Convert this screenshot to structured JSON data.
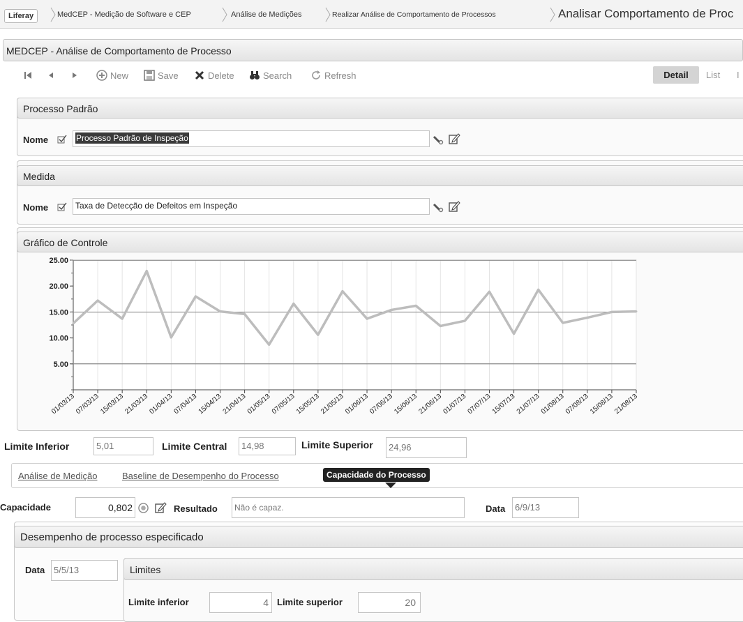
{
  "breadcrumb": {
    "items": [
      "Liferay",
      "MedCEP - Medição de Software e CEP",
      "Análise de Medições",
      "Realizar Análise de Comportamento de Processos"
    ],
    "current": "Analisar Comportamento de Proc"
  },
  "window": {
    "title": "MEDCEP - Análise de Comportamento de Processo"
  },
  "toolbar": {
    "new_label": "New",
    "save_label": "Save",
    "delete_label": "Delete",
    "search_label": "Search",
    "refresh_label": "Refresh",
    "view_detail": "Detail",
    "view_list": "List",
    "view_more": "I"
  },
  "processo": {
    "title": "Processo Padrão",
    "nome_label": "Nome",
    "nome_value": "Processo Padrão de Inspeção"
  },
  "medida": {
    "title": "Medida",
    "nome_label": "Nome",
    "nome_value": "Taxa de Detecção de Defeitos em Inspeção"
  },
  "grafico": {
    "title": "Gráfico de Controle"
  },
  "chart_data": {
    "type": "line",
    "x": [
      "01/03/13",
      "07/03/13",
      "15/03/13",
      "21/03/13",
      "01/04/13",
      "07/04/13",
      "15/04/13",
      "21/04/13",
      "01/05/13",
      "07/05/13",
      "15/05/13",
      "21/05/13",
      "01/06/13",
      "07/06/13",
      "15/06/13",
      "21/06/13",
      "01/07/13",
      "07/07/13",
      "15/07/13",
      "21/07/13",
      "01/08/13",
      "07/08/13",
      "15/08/13",
      "21/08/13"
    ],
    "series": [
      {
        "values": [
          12.8,
          17.2,
          13.7,
          22.9,
          10.1,
          18.0,
          15.1,
          14.6,
          8.7,
          16.6,
          10.6,
          19.0,
          13.7,
          15.4,
          16.2,
          12.3,
          13.3,
          18.9,
          10.8,
          19.3,
          12.9,
          13.9,
          15.0,
          15.1
        ]
      }
    ],
    "limits": {
      "lower": 5.01,
      "central": 14.98,
      "upper": 24.96
    },
    "yticks": [
      "25.00",
      "20.00",
      "15.00",
      "10.00",
      "5.00"
    ],
    "ylim": [
      0,
      25
    ],
    "line_color": "#bdbdbd",
    "limit_color": "#8a8a8a"
  },
  "limites": {
    "inferior_label": "Limite Inferior",
    "inferior_value": "5,01",
    "central_label": "Limite Central",
    "central_value": "14,98",
    "superior_label": "Limite Superior",
    "superior_value": "24,96"
  },
  "tabs": {
    "analise": "Análise de Medição",
    "baseline": "Baseline de Desempenho do Processo",
    "capacidade": "Capacidade do Processo"
  },
  "capacidade": {
    "label": "Capacidade",
    "value": "0,802",
    "resultado_label": "Resultado",
    "resultado_value": "Não é capaz.",
    "data_label": "Data",
    "data_value": "6/9/13"
  },
  "desempenho": {
    "title": "Desempenho de processo especificado",
    "data_label": "Data",
    "data_value": "5/5/13",
    "limites_title": "Limites",
    "inferior_label": "Limite inferior",
    "inferior_value": "4",
    "superior_label": "Limite superior",
    "superior_value": "20"
  }
}
